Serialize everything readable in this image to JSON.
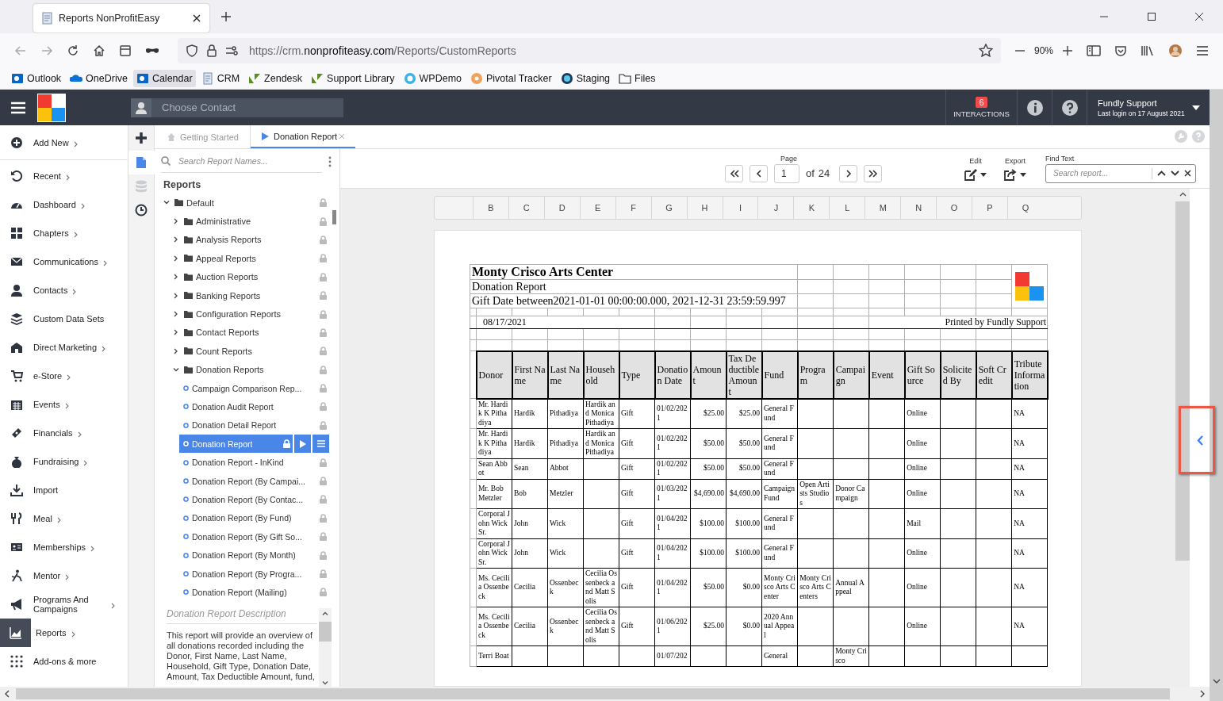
{
  "browser": {
    "tab_title": "Reports NonProfitEasy",
    "url": {
      "start": "https://crm.",
      "domain": "nonprofiteasy.com",
      "path": "/Reports/CustomReports"
    },
    "zoom": "90%",
    "bookmarks": [
      {
        "label": "Outlook",
        "highlighted": false
      },
      {
        "label": "OneDrive",
        "highlighted": false
      },
      {
        "label": "Calendar",
        "highlighted": true
      },
      {
        "label": "CRM",
        "highlighted": false
      },
      {
        "label": "Zendesk",
        "highlighted": false
      },
      {
        "label": "Support Library",
        "highlighted": false
      },
      {
        "label": "WPDemo",
        "highlighted": false
      },
      {
        "label": "Pivotal Tracker",
        "highlighted": false
      },
      {
        "label": "Staging",
        "highlighted": false
      },
      {
        "label": "Files",
        "highlighted": false
      }
    ]
  },
  "header": {
    "contact_placeholder": "Choose Contact",
    "interactions_count": "6",
    "interactions_label": "INTERACTIONS",
    "user_name": "Fundly Support",
    "last_login": "Last login on 17 August 2021"
  },
  "sidebar": {
    "items": [
      {
        "label": "Add New",
        "submenu": true,
        "selected": false
      },
      {
        "label": "Recent",
        "submenu": true,
        "selected": false
      },
      {
        "label": "Dashboard",
        "submenu": true,
        "selected": false
      },
      {
        "label": "Chapters",
        "submenu": true,
        "selected": false
      },
      {
        "label": "Communications",
        "submenu": true,
        "selected": false
      },
      {
        "label": "Contacts",
        "submenu": true,
        "selected": false
      },
      {
        "label": "Custom Data Sets",
        "submenu": false,
        "selected": false
      },
      {
        "label": "Direct Marketing",
        "submenu": true,
        "selected": false
      },
      {
        "label": "e-Store",
        "submenu": true,
        "selected": false
      },
      {
        "label": "Events",
        "submenu": true,
        "selected": false
      },
      {
        "label": "Financials",
        "submenu": true,
        "selected": false
      },
      {
        "label": "Fundraising",
        "submenu": true,
        "selected": false
      },
      {
        "label": "Import",
        "submenu": false,
        "selected": false
      },
      {
        "label": "Meal",
        "submenu": true,
        "selected": false
      },
      {
        "label": "Memberships",
        "submenu": true,
        "selected": false
      },
      {
        "label": "Mentor",
        "submenu": true,
        "selected": false
      },
      {
        "label": "Programs And Campaigns",
        "submenu": true,
        "selected": false
      },
      {
        "label": "Reports",
        "submenu": true,
        "selected": true
      },
      {
        "label": "Add-ons & more",
        "submenu": false,
        "selected": false
      }
    ]
  },
  "tabs": [
    {
      "label": "Getting Started",
      "selected": false,
      "kind": "home"
    },
    {
      "label": "Donation Report",
      "selected": true,
      "kind": "report"
    }
  ],
  "tree": {
    "search_placeholder": "Search Report Names...",
    "heading": "Reports",
    "items": [
      {
        "label": "Default",
        "kind": "folder",
        "expanded": true,
        "locked": true,
        "children": [
          {
            "label": "Administrative",
            "kind": "folder",
            "expanded": false,
            "locked": true
          },
          {
            "label": "Analysis Reports",
            "kind": "folder",
            "expanded": false,
            "locked": true
          },
          {
            "label": "Appeal Reports",
            "kind": "folder",
            "expanded": false,
            "locked": true
          },
          {
            "label": "Auction Reports",
            "kind": "folder",
            "expanded": false,
            "locked": true
          },
          {
            "label": "Banking Reports",
            "kind": "folder",
            "expanded": false,
            "locked": true
          },
          {
            "label": "Configuration Reports",
            "kind": "folder",
            "expanded": false,
            "locked": true
          },
          {
            "label": "Contact Reports",
            "kind": "folder",
            "expanded": false,
            "locked": true
          },
          {
            "label": "Count Reports",
            "kind": "folder",
            "expanded": false,
            "locked": true
          },
          {
            "label": "Donation Reports",
            "kind": "folder",
            "expanded": true,
            "locked": true,
            "children": [
              {
                "label": "Campaign Comparison Rep...",
                "kind": "report",
                "selected": false,
                "locked": true
              },
              {
                "label": "Donation Audit Report",
                "kind": "report",
                "selected": false,
                "locked": true
              },
              {
                "label": "Donation Detail Report",
                "kind": "report",
                "selected": false,
                "locked": true
              },
              {
                "label": "Donation Report",
                "kind": "report",
                "selected": true,
                "locked": true
              },
              {
                "label": "Donation Report - InKind",
                "kind": "report",
                "selected": false,
                "locked": true
              },
              {
                "label": "Donation Report (By Campai...",
                "kind": "report",
                "selected": false,
                "locked": true
              },
              {
                "label": "Donation Report (By Contac...",
                "kind": "report",
                "selected": false,
                "locked": true
              },
              {
                "label": "Donation Report (By Fund)",
                "kind": "report",
                "selected": false,
                "locked": true
              },
              {
                "label": "Donation Report (By Gift So...",
                "kind": "report",
                "selected": false,
                "locked": true
              },
              {
                "label": "Donation Report (By Month)",
                "kind": "report",
                "selected": false,
                "locked": true
              },
              {
                "label": "Donation Report (By Progra...",
                "kind": "report",
                "selected": false,
                "locked": true
              },
              {
                "label": "Donation Report (Mailing)",
                "kind": "report",
                "selected": false,
                "locked": true
              }
            ]
          }
        ]
      }
    ],
    "description_title": "Donation Report Description",
    "description": "This report will provide an overview of all donations recorded including the Donor, First Name, Last Name, Household, Gift Type, Donation Date, Amount, Tax Deductible Amount, fund,"
  },
  "toolbar": {
    "page_label": "Page",
    "page": "1",
    "of": "of",
    "page_count": "24",
    "edit_label": "Edit",
    "export_label": "Export",
    "find_label": "Find Text",
    "find_placeholder": "Search report..."
  },
  "sheet_columns": [
    "B",
    "C",
    "D",
    "E",
    "F",
    "G",
    "H",
    "I",
    "J",
    "K",
    "L",
    "M",
    "N",
    "O",
    "P",
    "Q"
  ],
  "report": {
    "title": "Monty Crisco Arts Center",
    "subtitle": "Donation Report",
    "criteria": "Gift Date between2021-01-01 00:00:00.000, 2021-12-31 23:59:59.997",
    "date": "08/17/2021",
    "printed_by": "Printed by Fundly Support",
    "columns": [
      "Donor",
      "First Name",
      "Last Name",
      "Household",
      "Type",
      "Donation Date",
      "Amount",
      "Tax Deductible Amount",
      "Fund",
      "Program",
      "Campaign",
      "Event",
      "Gift Source",
      "Solicited By",
      "Soft Credit",
      "Tribute Information"
    ],
    "rows": [
      [
        "Mr. Hardik K Pithadiya",
        "Hardik",
        "Pithadiya",
        "Hardik and Monica Pithadiya",
        "Gift",
        "01/02/2021",
        "$25.00",
        "$25.00",
        "General Fund",
        "",
        "",
        "",
        "Online",
        "",
        "",
        "NA"
      ],
      [
        "Mr. Hardik K Pithadiya",
        "Hardik",
        "Pithadiya",
        "Hardik and Monica Pithadiya",
        "Gift",
        "01/02/2021",
        "$50.00",
        "$50.00",
        "General Fund",
        "",
        "",
        "",
        "Online",
        "",
        "",
        "NA"
      ],
      [
        "Sean Abbot",
        "Sean",
        "Abbot",
        "",
        "Gift",
        "01/02/2021",
        "$50.00",
        "$50.00",
        "General Fund",
        "",
        "",
        "",
        "Online",
        "",
        "",
        "NA"
      ],
      [
        "Mr. Bob Metzler",
        "Bob",
        "Metzler",
        "",
        "Gift",
        "01/03/2021",
        "$4,690.00",
        "$4,690.00",
        "Campaign Fund",
        "Open Artists Studios",
        "Donor Campaign",
        "",
        "Online",
        "",
        "",
        "NA"
      ],
      [
        "Corporal John Wick Sr.",
        "John",
        "Wick",
        "",
        "Gift",
        "01/04/2021",
        "$100.00",
        "$100.00",
        "General Fund",
        "",
        "",
        "",
        "Mail",
        "",
        "",
        "NA"
      ],
      [
        "Corporal John Wick Sr.",
        "John",
        "Wick",
        "",
        "Gift",
        "01/04/2021",
        "$100.00",
        "$100.00",
        "General Fund",
        "",
        "",
        "",
        "Online",
        "",
        "",
        "NA"
      ],
      [
        "Ms. Cecilia Ossenbeck",
        "Cecilia",
        "Ossenbeck",
        "Cecilia Ossenbeck and Matt Solis",
        "Gift",
        "01/04/2021",
        "$50.00",
        "$0.00",
        "Monty Crisco Arts Center",
        "Monty Crisco Arts Centers",
        "Annual Appeal",
        "",
        "Online",
        "",
        "",
        "NA"
      ],
      [
        "Ms. Cecilia Ossenbeck",
        "Cecilia",
        "Ossenbeck",
        "Cecilia Ossenbeck and Matt Solis",
        "Gift",
        "01/06/2021",
        "$25.00",
        "$0.00",
        "2020 Annual Appeal",
        "",
        "",
        "",
        "Online",
        "",
        "",
        "NA"
      ],
      [
        "Terri Boat",
        "",
        "",
        "",
        "",
        "01/07/202",
        "",
        "",
        "General",
        "",
        "Monty Crisco",
        "",
        "",
        "",
        "",
        ""
      ]
    ]
  }
}
